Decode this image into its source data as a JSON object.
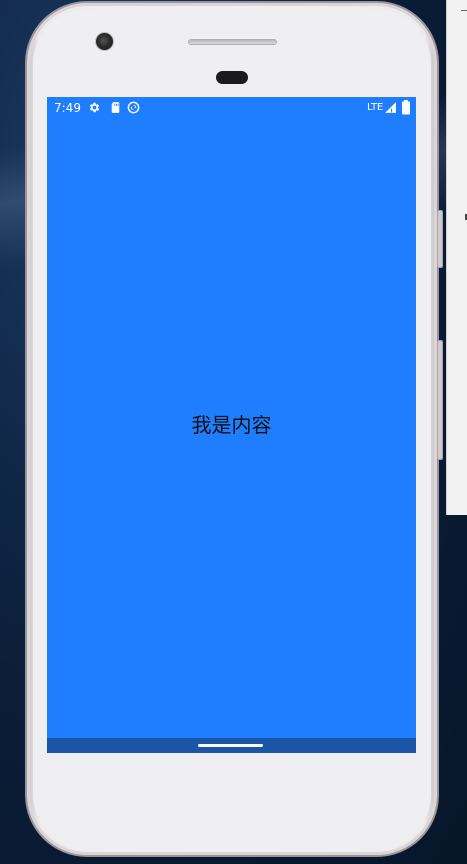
{
  "status_bar": {
    "time": "7:49",
    "network": "LTE",
    "icons": [
      "settings-gear-icon",
      "sd-card-icon",
      "sync-icon",
      "signal-icon",
      "battery-icon"
    ]
  },
  "content": {
    "text": "我是内容",
    "background_color": "#1f7dff"
  },
  "navigation": {
    "bar_color": "#1b56a6",
    "handle": "home-gesture-handle"
  }
}
